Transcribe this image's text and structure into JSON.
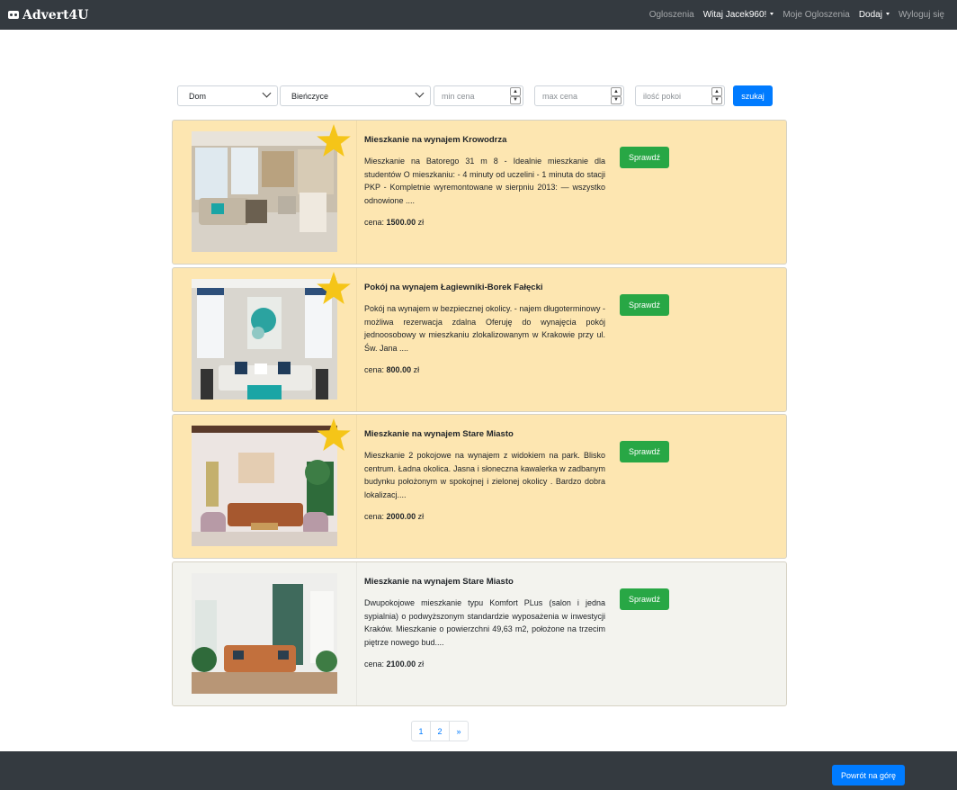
{
  "navbar": {
    "brand": "Advert4U",
    "links": {
      "ogloszenia": "Ogloszenia",
      "user": "Witaj Jacek960!",
      "moje": "Moje Ogloszenia",
      "dodaj": "Dodaj",
      "logout": "Wyloguj się"
    }
  },
  "search": {
    "type_value": "Dom",
    "district_value": "Bieńczyce",
    "min_price_placeholder": "min cena",
    "max_price_placeholder": "max cena",
    "rooms_placeholder": "ilość pokoi",
    "submit_label": "szukaj"
  },
  "listings": [
    {
      "title": "Mieszkanie na wynajem Krowodrza",
      "description": "Mieszkanie na Batorego 31 m 8 - Idealnie mieszkanie dla studentów O mieszkaniu: - 4 minuty od uczelini - 1 minuta do stacji PKP - Kompletnie wyremontowane w sierpniu 2013: — wszystko odnowione ....",
      "price_label": "cena:",
      "price": "1500.00",
      "currency": "zł",
      "button": "Sprawdź",
      "promoted": true
    },
    {
      "title": "Pokój na wynajem Łagiewniki-Borek Fałęcki",
      "description": "Pokój na wynajem w bezpiecznej okolicy. - najem długoterminowy - możliwa rezerwacja zdalna Oferuję do wynajęcia pokój jednoosobowy w mieszkaniu zlokalizowanym w Krakowie przy ul. Św. Jana ....",
      "price_label": "cena:",
      "price": "800.00",
      "currency": "zł",
      "button": "Sprawdź",
      "promoted": true
    },
    {
      "title": "Mieszkanie na wynajem Stare Miasto",
      "description": "Mieszkanie 2 pokojowe na wynajem z widokiem na park. Blisko centrum. Ładna okolica. Jasna i słoneczna kawalerka w zadbanym budynku położonym w spokojnej i zielonej okolicy . Bardzo dobra lokalizacj....",
      "price_label": "cena:",
      "price": "2000.00",
      "currency": "zł",
      "button": "Sprawdź",
      "promoted": true
    },
    {
      "title": "Mieszkanie na wynajem Stare Miasto",
      "description": "Dwupokojowe mieszkanie typu Komfort PLus (salon i jedna sypialnia) o podwyższonym standardzie wyposażenia w inwestycji Kraków. Mieszkanie o powierzchni 49,63 m2, położone na trzecim piętrze nowego bud....",
      "price_label": "cena:",
      "price": "2100.00",
      "currency": "zł",
      "button": "Sprawdź",
      "promoted": false
    }
  ],
  "pagination": {
    "pages": [
      "1",
      "2"
    ],
    "next": "»"
  },
  "footer": {
    "back_to_top": "Powrót na górę"
  },
  "colors": {
    "navbar_bg": "#343a40",
    "promo_card_bg": "#fde6b1",
    "plain_card_bg": "#f3f3ee",
    "primary": "#007bff",
    "success": "#28a745",
    "star": "#f5c518"
  },
  "icons": {
    "brand": "car-icon",
    "promoted": "star-icon",
    "dropdown": "chevron-down-icon",
    "spinner": "spinner-arrows-icon"
  }
}
